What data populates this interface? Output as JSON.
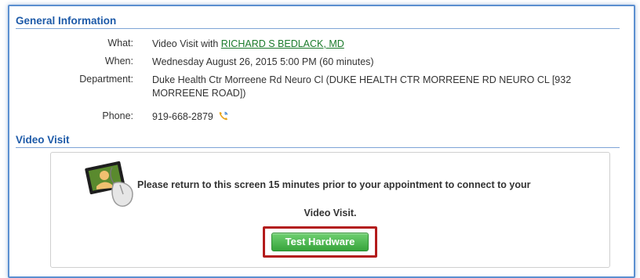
{
  "general": {
    "title": "General Information",
    "what_label": "What:",
    "what_prefix": "Video Visit with",
    "doctor": "RICHARD S BEDLACK, MD",
    "when_label": "When:",
    "when_value": "Wednesday August 26, 2015 5:00 PM (60 minutes)",
    "department_label": "Department:",
    "department_value": "Duke Health Ctr Morreene Rd Neuro Cl (DUKE HEALTH CTR MORREENE RD NEURO CL [932 MORREENE ROAD])",
    "phone_label": "Phone:",
    "phone_value": "919-668-2879"
  },
  "video": {
    "title": "Video Visit",
    "message_line1": "Please return to this screen 15 minutes prior to your appointment to connect to your",
    "message_line2": "Video Visit.",
    "button_label": "Test Hardware",
    "icon": "video-camera-icon"
  },
  "colors": {
    "heading": "#1d5aa8",
    "link": "#1a7a2a",
    "button": "#37a43b",
    "highlight": "#b31b1b",
    "frame": "#5b8fd0"
  }
}
